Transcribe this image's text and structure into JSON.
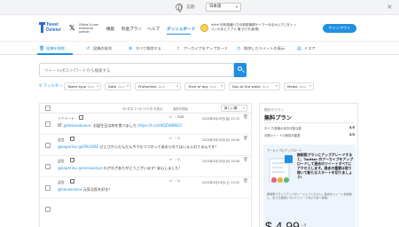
{
  "langbar": {
    "label": "言語:",
    "selected": "日本語"
  },
  "brand": {
    "name_line1": "Tweet",
    "name_line2": "Deleter",
    "colors": {
      "primary": "#1f8fe0",
      "logo": "#2b6fc2"
    }
  },
  "partner": {
    "x_logo": "𝕏",
    "text": "Official X.com enterprise partner"
  },
  "nav": {
    "items": [
      "機能",
      "料金プラン",
      "ヘルプ",
      "ダッシュボード"
    ]
  },
  "user": {
    "name": "※※※ 何系各種バズの新型機械ゲーマーゆるかいでじをレッスンかまどアプリ 事でけき(新規)"
  },
  "signin": {
    "label": "サインアウト"
  },
  "tabs": [
    {
      "label": "投稿を削除",
      "icon": "trash-icon"
    },
    {
      "label": "投稿の取消",
      "icon": "undo-icon"
    },
    {
      "label": "すべて削除する",
      "icon": "delete-all-icon"
    },
    {
      "label": "アーカイブをアップロード",
      "icon": "upload-icon"
    },
    {
      "label": "削除したツイートの表示",
      "icon": "history-icon"
    },
    {
      "label": "ドスア",
      "icon": "doc-icon"
    }
  ],
  "search": {
    "placeholder": "ツイート/ポスト/ワードから検索する"
  },
  "filters": {
    "label": "フィルター",
    "any": "Any",
    "items": [
      "Tweet type",
      "Date",
      "Profanities",
      "Time of day",
      "Day of the week",
      "Media"
    ]
  },
  "table": {
    "count_text": "50 件中 1〜の 175 件 を表示",
    "delete_selected": "選択を削除",
    "sort": "新しい順",
    "rows": [
      {
        "kind": "リツイート",
        "replies": "",
        "retweets": "",
        "likes": "826",
        "date": "2024年3月29日(金) 12:13",
        "text_prefix": "RT ",
        "mention": "@hatanakanon",
        "text": ": お誕生日は何を食べました ",
        "url": "https://t.co/t9QZWBNG5"
      },
      {
        "kind": "返信",
        "replies": "",
        "retweets": "",
        "likes": "0",
        "date": "2024年3月25日(月) 16:28",
        "text_prefix": "",
        "mention": "@kaperinu @OPLUSRE",
        "text": " せとさからだんだん今でもつつかってあおられてはいえ入れてるんです!",
        "url": ""
      },
      {
        "kind": "返信",
        "replies": "",
        "retweets": "",
        "likes": "0",
        "date": "2024年3月25日(月) 16:08",
        "text_prefix": "",
        "mention": "@kaperinu @narasuroye",
        "text": " わざわざありがとうございます!   安心しました!",
        "url": ""
      },
      {
        "kind": "返信",
        "replies": "",
        "retweets": "",
        "likes": "0",
        "date": "2024年3月23日(土) 10:52",
        "text_prefix": "",
        "mention": "@hanasisune",
        "text": " 元気な役を好き!",
        "url": ""
      }
    ]
  },
  "plan": {
    "label": "現在のプラン",
    "name": "無料プラン",
    "quotas": [
      {
        "label": "タイプ/投稿の消去可能な数",
        "value": "5/5"
      },
      {
        "label": "月間ツイートの削除可能数",
        "value": "5/5"
      }
    ],
    "promo_small": "アーカイブのアップロード",
    "promo_text": "無制限プランにアップグレードすると、Twitter のアーカイブをアップロードして過去のツイートすべてにアクセスします。過去の重要は取り除いて新たなスタートを切りましょう!",
    "promo_fine": "無制限プランへアップグレードしてください。過去のツイートを削除し、全ての投稿についてツイートをより多く削除。",
    "price": "$ 4.99",
    "price_sub": "/ 月"
  }
}
